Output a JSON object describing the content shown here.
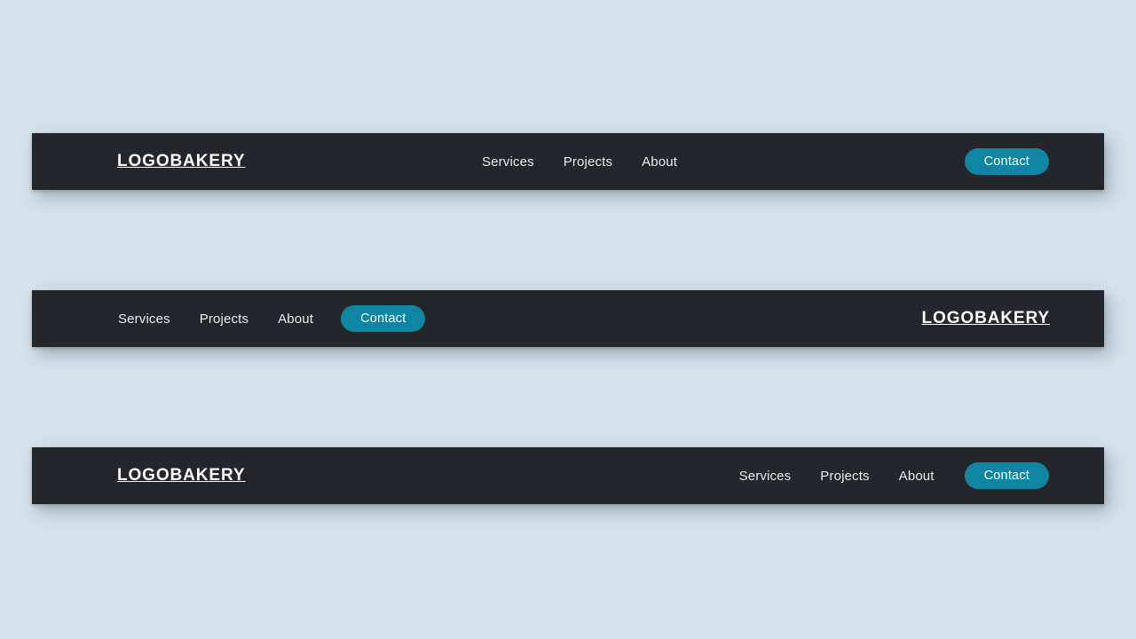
{
  "page": {
    "background_color": "#d7e2ea",
    "bar_color": "#24262b",
    "accent_color": "#0e86a3",
    "nav_text_color": "#e9ecef",
    "logo_text_color": "#ffffff"
  },
  "brand": {
    "name": "LOGOBAKERY"
  },
  "nav": {
    "links": [
      {
        "label": "Services"
      },
      {
        "label": "Projects"
      },
      {
        "label": "About"
      }
    ],
    "cta": {
      "label": "Contact"
    }
  },
  "navbars": [
    {
      "id": "navbar-1",
      "variant": "logo-left-links-center-cta-right"
    },
    {
      "id": "navbar-2",
      "variant": "links-cta-left-logo-right"
    },
    {
      "id": "navbar-3",
      "variant": "logo-left-links-cta-right"
    }
  ]
}
